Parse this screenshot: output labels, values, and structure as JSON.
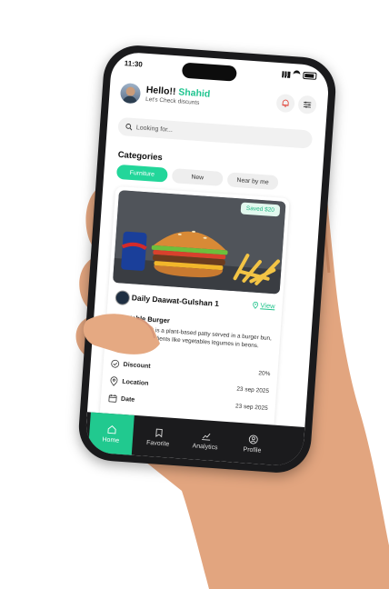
{
  "status": {
    "time": "11:30"
  },
  "header": {
    "greeting": "Hello!! ",
    "name": "Shahid",
    "subtitle": "Let's Check discunts"
  },
  "search": {
    "placeholder": "Looking for..."
  },
  "categories": {
    "title": "Categories",
    "items": [
      {
        "label": "Furniture",
        "active": true
      },
      {
        "label": "New",
        "active": false
      },
      {
        "label": "Near by me",
        "active": false
      }
    ]
  },
  "card": {
    "badge": "Saved $20",
    "restaurant": "Daily Daawat-Gulshan 1",
    "view_label": "View",
    "dish": "Vegetable Burger",
    "description": "A veggie burger is a plant-based patty served in a burger bun, made from ingredients like vegetables legumes in beons.",
    "details": [
      {
        "label": "Discount",
        "value": "20%",
        "icon": "check-circle-icon"
      },
      {
        "label": "Location",
        "value": "23 sep 2025",
        "icon": "location-pin-icon"
      },
      {
        "label": "Date",
        "value": "23 sep 2025",
        "icon": "calendar-icon"
      }
    ]
  },
  "tabs": [
    {
      "label": "Home",
      "icon": "home-icon",
      "active": true
    },
    {
      "label": "Favorite",
      "icon": "bookmark-icon",
      "active": false
    },
    {
      "label": "Analytics",
      "icon": "chart-icon",
      "active": false
    },
    {
      "label": "Profile",
      "icon": "profile-icon",
      "active": false
    }
  ],
  "colors": {
    "accent": "#23d69a",
    "tabbar": "#1b1b1d"
  }
}
